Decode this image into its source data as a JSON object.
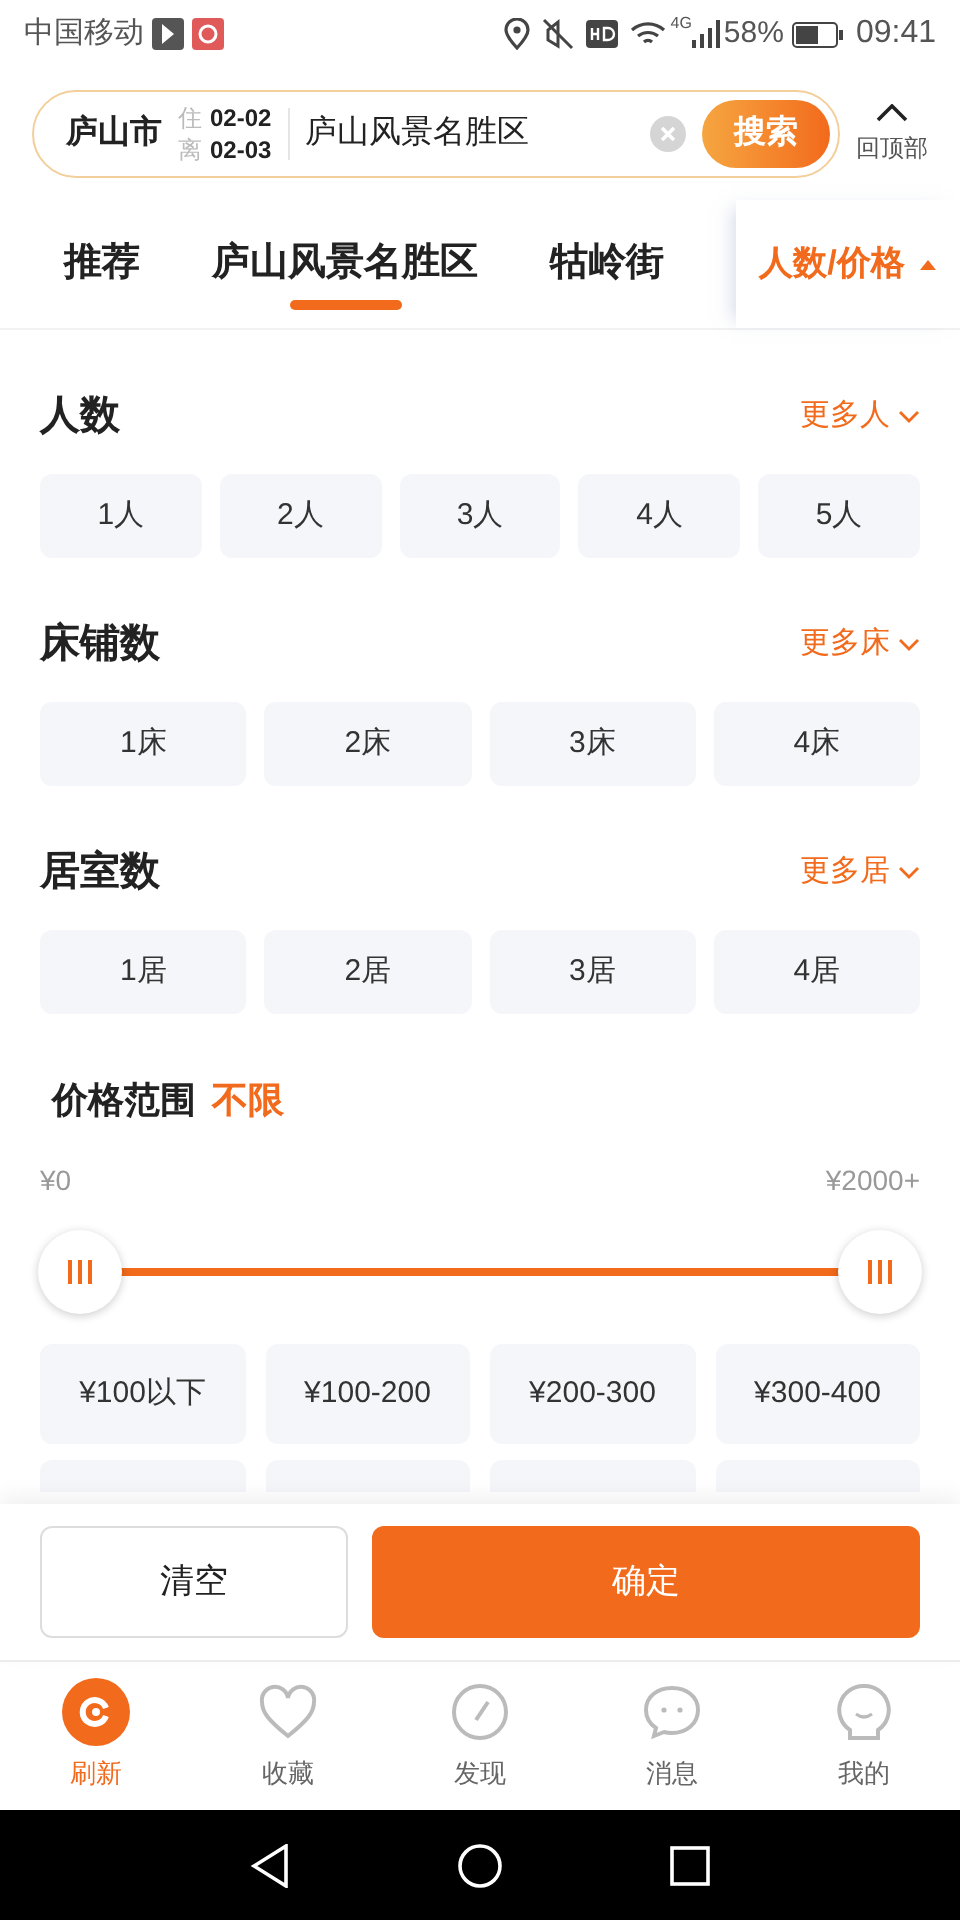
{
  "status_bar": {
    "carrier": "中国移动",
    "network": "4G",
    "battery": "58%",
    "time": "09:41"
  },
  "search_bar": {
    "city": "庐山市",
    "checkin_label": "住",
    "checkin": "02-02",
    "checkout_label": "离",
    "checkout": "02-03",
    "query": "庐山风景名胜区",
    "search_button": "搜索",
    "top_button": "回顶部"
  },
  "tabs": [
    {
      "label": "推荐",
      "kind": "tab",
      "selected": false
    },
    {
      "label": "庐山风景名胜区",
      "kind": "tab",
      "selected": true
    },
    {
      "label": "牯岭街",
      "kind": "tab",
      "selected": false
    },
    {
      "label": "人数/价格",
      "kind": "filter",
      "expanded": true
    }
  ],
  "sections": [
    {
      "title": "人数",
      "more": "更多人",
      "options": [
        {
          "label": "1人",
          "selected": false
        },
        {
          "label": "2人",
          "selected": false
        },
        {
          "label": "3人",
          "selected": false
        },
        {
          "label": "4人",
          "selected": false
        },
        {
          "label": "5人",
          "selected": false
        }
      ]
    },
    {
      "title": "床铺数",
      "more": "更多床",
      "options": [
        {
          "label": "1床",
          "selected": false
        },
        {
          "label": "2床",
          "selected": false
        },
        {
          "label": "3床",
          "selected": false
        },
        {
          "label": "4床",
          "selected": false
        }
      ]
    },
    {
      "title": "居室数",
      "more": "更多居",
      "options": [
        {
          "label": "1居",
          "selected": false
        },
        {
          "label": "2居",
          "selected": false
        },
        {
          "label": "3居",
          "selected": false
        },
        {
          "label": "4居",
          "selected": false
        }
      ]
    }
  ],
  "price": {
    "title": "价格范围",
    "value": "不限",
    "min_label": "¥0",
    "max_label": "¥2000+",
    "options": [
      {
        "label": "¥100以下",
        "selected": false
      },
      {
        "label": "¥100-200",
        "selected": false
      },
      {
        "label": "¥200-300",
        "selected": false
      },
      {
        "label": "¥300-400",
        "selected": false
      }
    ]
  },
  "actions": {
    "clear": "清空",
    "confirm": "确定"
  },
  "bottom_nav": [
    {
      "label": "刷新",
      "selected": true
    },
    {
      "label": "收藏",
      "selected": false
    },
    {
      "label": "发现",
      "selected": false
    },
    {
      "label": "消息",
      "selected": false
    },
    {
      "label": "我的",
      "selected": false
    }
  ]
}
